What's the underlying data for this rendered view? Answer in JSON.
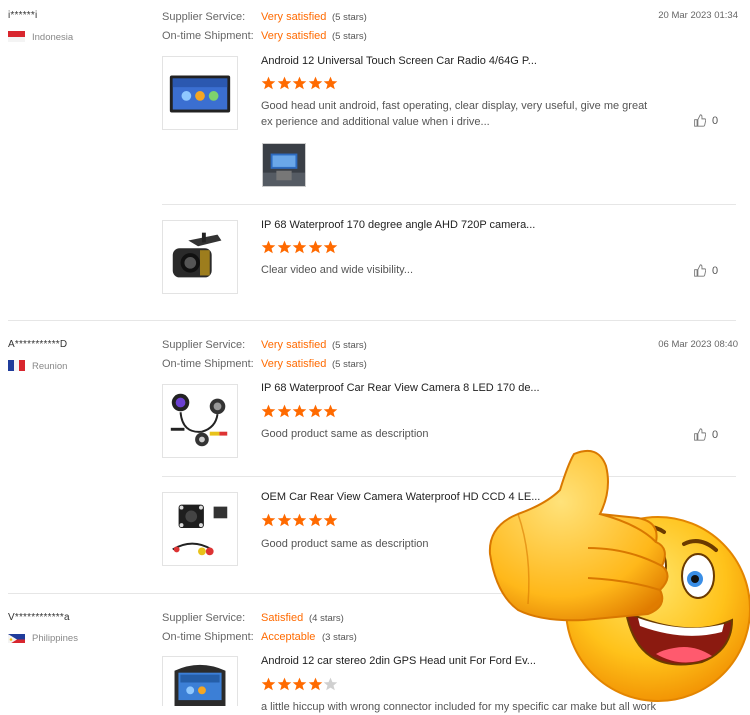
{
  "reviews": [
    {
      "buyer": "i******i",
      "country": "Indonesia",
      "date": "20 Mar 2023 01:34",
      "supplier_label": "Supplier Service:",
      "supplier_value": "Very satisfied",
      "supplier_stars": "(5 stars)",
      "shipment_label": "On-time Shipment:",
      "shipment_value": "Very satisfied",
      "shipment_stars": "(5 stars)",
      "items": [
        {
          "title": "Android 12 Universal Touch Screen Car Radio 4/64G P...",
          "rating": 5,
          "text": "Good head unit android, fast operating, clear display, very useful, give me great ex perience and additional value when i drive...",
          "helpful": "0"
        },
        {
          "title": "IP 68 Waterproof 170 degree angle AHD 720P camera...",
          "rating": 5,
          "text": "Clear video and wide visibility...",
          "helpful": "0"
        }
      ]
    },
    {
      "buyer": "A***********D",
      "country": "Reunion",
      "date": "06 Mar 2023 08:40",
      "supplier_label": "Supplier Service:",
      "supplier_value": "Very satisfied",
      "supplier_stars": "(5 stars)",
      "shipment_label": "On-time Shipment:",
      "shipment_value": "Very satisfied",
      "shipment_stars": "(5 stars)",
      "items": [
        {
          "title": "IP 68 Waterproof Car Rear View Camera 8 LED 170 de...",
          "rating": 5,
          "text": "Good product same as description",
          "helpful": "0"
        },
        {
          "title": "OEM Car Rear View Camera Waterproof HD CCD 4 LE...",
          "rating": 5,
          "text": "Good product same as description",
          "helpful": ""
        }
      ]
    },
    {
      "buyer": "V************a",
      "country": "Philippines",
      "date": "",
      "supplier_label": "Supplier Service:",
      "supplier_value": "Satisfied",
      "supplier_stars": "(4 stars)",
      "shipment_label": "On-time Shipment:",
      "shipment_value": "Acceptable",
      "shipment_stars": "(3 stars)",
      "items": [
        {
          "title": "Android 12 car stereo 2din GPS Head unit For Ford Ev...",
          "rating": 4,
          "text": "a little hiccup with wrong connector included for my specific car make but all work",
          "helpful": ""
        }
      ]
    }
  ],
  "colors": {
    "accent": "#ff6a00",
    "star_empty": "#d0d0d0"
  },
  "icons": {
    "helpful": "thumbs-up-icon",
    "star": "star-icon",
    "overlay": "thumbs-up-emoji-icon"
  }
}
